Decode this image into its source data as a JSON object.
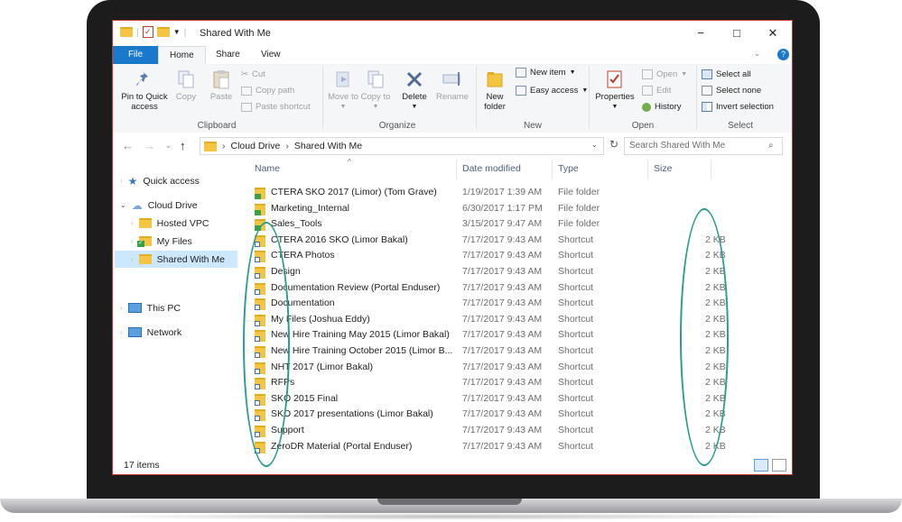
{
  "window": {
    "title": "Shared With Me",
    "controls": {
      "minimize": "−",
      "maximize": "□",
      "close": "✕"
    },
    "help": "?"
  },
  "ribbon_tabs": [
    "File",
    "Home",
    "Share",
    "View"
  ],
  "ribbon": {
    "clipboard": {
      "label": "Clipboard",
      "pin": "Pin to Quick access",
      "copy": "Copy",
      "paste": "Paste",
      "cut": "Cut",
      "copy_path": "Copy path",
      "paste_shortcut": "Paste shortcut"
    },
    "organize": {
      "label": "Organize",
      "move_to": "Move to",
      "copy_to": "Copy to",
      "delete": "Delete",
      "rename": "Rename"
    },
    "new": {
      "label": "New",
      "new_folder": "New folder",
      "new_item": "New item",
      "easy_access": "Easy access"
    },
    "open": {
      "label": "Open",
      "properties": "Properties",
      "open": "Open",
      "edit": "Edit",
      "history": "History"
    },
    "select": {
      "label": "Select",
      "select_all": "Select all",
      "select_none": "Select none",
      "invert_selection": "Invert selection"
    }
  },
  "address": {
    "crumbs": [
      "Cloud Drive",
      "Shared With Me"
    ],
    "search_placeholder": "Search Shared With Me"
  },
  "nav": {
    "items": [
      {
        "label": "Quick access",
        "icon": "star-icon"
      },
      {
        "label": "Cloud Drive",
        "icon": "cloud-icon"
      },
      {
        "label": "Hosted VPC",
        "icon": "folder-icon"
      },
      {
        "label": "My Files",
        "icon": "folder-synced-icon"
      },
      {
        "label": "Shared With Me",
        "icon": "folder-icon",
        "selected": true
      },
      {
        "label": "This PC",
        "icon": "computer-icon"
      },
      {
        "label": "Network",
        "icon": "network-icon"
      }
    ]
  },
  "columns": {
    "name": "Name",
    "date": "Date modified",
    "type": "Type",
    "size": "Size"
  },
  "files": [
    {
      "name": "CTERA SKO 2017 (Limor) (Tom Grave)",
      "date": "1/19/2017 1:39 AM",
      "type": "File folder",
      "size": "",
      "kind": "folder"
    },
    {
      "name": "Marketing_Internal",
      "date": "6/30/2017 1:17 PM",
      "type": "File folder",
      "size": "",
      "kind": "folder"
    },
    {
      "name": "Sales_Tools",
      "date": "3/15/2017 9:47 AM",
      "type": "File folder",
      "size": "",
      "kind": "folder"
    },
    {
      "name": "CTERA 2016 SKO (Limor Bakal)",
      "date": "7/17/2017 9:43 AM",
      "type": "Shortcut",
      "size": "2 KB",
      "kind": "shortcut"
    },
    {
      "name": "CTERA Photos",
      "date": "7/17/2017 9:43 AM",
      "type": "Shortcut",
      "size": "2 KB",
      "kind": "shortcut"
    },
    {
      "name": "Design",
      "date": "7/17/2017 9:43 AM",
      "type": "Shortcut",
      "size": "2 KB",
      "kind": "shortcut"
    },
    {
      "name": "Documentation Review (Portal Enduser)",
      "date": "7/17/2017 9:43 AM",
      "type": "Shortcut",
      "size": "2 KB",
      "kind": "shortcut"
    },
    {
      "name": "Documentation",
      "date": "7/17/2017 9:43 AM",
      "type": "Shortcut",
      "size": "2 KB",
      "kind": "shortcut"
    },
    {
      "name": "My Files (Joshua Eddy)",
      "date": "7/17/2017 9:43 AM",
      "type": "Shortcut",
      "size": "2 KB",
      "kind": "shortcut"
    },
    {
      "name": "New Hire Training May 2015 (Limor Bakal)",
      "date": "7/17/2017 9:43 AM",
      "type": "Shortcut",
      "size": "2 KB",
      "kind": "shortcut"
    },
    {
      "name": "New Hire Training October 2015 (Limor B...",
      "date": "7/17/2017 9:43 AM",
      "type": "Shortcut",
      "size": "2 KB",
      "kind": "shortcut"
    },
    {
      "name": "NHT 2017 (Limor Bakal)",
      "date": "7/17/2017 9:43 AM",
      "type": "Shortcut",
      "size": "2 KB",
      "kind": "shortcut"
    },
    {
      "name": "RFPs",
      "date": "7/17/2017 9:43 AM",
      "type": "Shortcut",
      "size": "2 KB",
      "kind": "shortcut"
    },
    {
      "name": "SKO 2015 Final",
      "date": "7/17/2017 9:43 AM",
      "type": "Shortcut",
      "size": "2 KB",
      "kind": "shortcut"
    },
    {
      "name": "SKO 2017 presentations (Limor Bakal)",
      "date": "7/17/2017 9:43 AM",
      "type": "Shortcut",
      "size": "2 KB",
      "kind": "shortcut"
    },
    {
      "name": "Support",
      "date": "7/17/2017 9:43 AM",
      "type": "Shortcut",
      "size": "2 KB",
      "kind": "shortcut"
    },
    {
      "name": "ZeroDR Material (Portal Enduser)",
      "date": "7/17/2017 9:43 AM",
      "type": "Shortcut",
      "size": "2 KB",
      "kind": "shortcut"
    }
  ],
  "status": {
    "item_count": "17 items"
  },
  "colors": {
    "accent": "#1979ca",
    "folder": "#f4c542",
    "annotation": "#2a9d8f",
    "selected": "#cce8ff"
  }
}
